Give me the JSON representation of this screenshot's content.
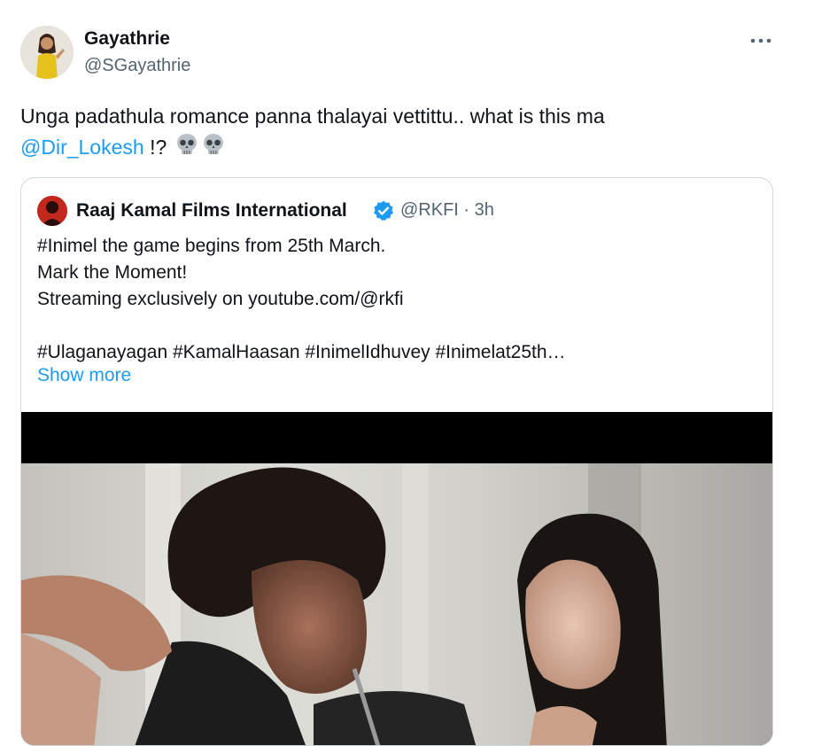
{
  "tweet": {
    "author_name": "Gayathrie",
    "author_handle": "@SGayathrie",
    "more_icon": "more-horizontal-icon",
    "text_part1": "Unga padathula romance panna thalayai vettittu.. what is this ma",
    "mention": "@Dir_Lokesh",
    "text_part2": " !?",
    "emoji_names": [
      "skull-emoji",
      "skull-emoji"
    ]
  },
  "quote": {
    "author_name": "Raaj Kamal Films International",
    "verified_icon": "verified-badge-icon",
    "author_handle": "@RKFI",
    "separator": "·",
    "time": "3h",
    "body": "#Inimel the game begins from 25th March.\nMark the Moment!\nStreaming exclusively on youtube.com/@rkfi\n\n#Ulaganayagan #KamalHaasan #InimelIdhuvey #Inimelat25th…",
    "show_more": "Show more",
    "media": "video-still"
  },
  "colors": {
    "link": "#1d9bf0",
    "secondary_text": "#536471",
    "border": "#cfd9de",
    "verified": "#1d9bf0"
  }
}
